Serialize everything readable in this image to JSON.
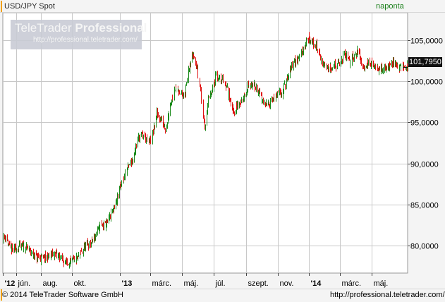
{
  "header": {
    "title": "USD/JPY Spot",
    "interval": "naponta"
  },
  "watermark": {
    "brand_plain": "TeleTrader",
    "brand_bold": "Professional",
    "url": "http://professional.teletrader.com/"
  },
  "footer": {
    "copyright": "© 2014 TeleTrader Software GmbH",
    "url": "http://professional.teletrader.com/"
  },
  "last_value_label": "101,7950",
  "colors": {
    "up": "#1a8a1a",
    "down": "#e01010",
    "grid": "#c8c8c8",
    "plot_background": "#ffffff",
    "frame": "#999999"
  },
  "chart_data": {
    "type": "candlestick",
    "instrument": "USD/JPY Spot",
    "frequency": "naponta",
    "grid": true,
    "y_axis_position": "right",
    "x_range": [
      "2012-05-20",
      "2014-07-10"
    ],
    "y_range": [
      76.6,
      108.4
    ],
    "y_ticks": [
      {
        "value": 80,
        "label": "80,0000"
      },
      {
        "value": 85,
        "label": "85,0000"
      },
      {
        "value": 90,
        "label": "90,0000"
      },
      {
        "value": 95,
        "label": "95,0000"
      },
      {
        "value": 100,
        "label": "100,0000"
      },
      {
        "value": 105,
        "label": "105,0000"
      }
    ],
    "x_ticks": [
      {
        "date": "2012-05-20",
        "label": "'12",
        "bold": true
      },
      {
        "date": "2012-06-15",
        "label": "jún.",
        "bold": false
      },
      {
        "date": "2012-08-01",
        "label": "aug.",
        "bold": false
      },
      {
        "date": "2012-10-01",
        "label": "okt.",
        "bold": false
      },
      {
        "date": "2013-01-01",
        "label": "'13",
        "bold": true
      },
      {
        "date": "2013-03-01",
        "label": "márc.",
        "bold": false
      },
      {
        "date": "2013-05-01",
        "label": "máj.",
        "bold": false
      },
      {
        "date": "2013-07-01",
        "label": "júl.",
        "bold": false
      },
      {
        "date": "2013-09-01",
        "label": "szept.",
        "bold": false
      },
      {
        "date": "2013-11-01",
        "label": "nov.",
        "bold": false
      },
      {
        "date": "2014-01-01",
        "label": "'14",
        "bold": true
      },
      {
        "date": "2014-03-01",
        "label": "márc.",
        "bold": false
      },
      {
        "date": "2014-05-01",
        "label": "máj.",
        "bold": false
      }
    ],
    "last_value": 101.795,
    "close_path": [
      [
        "2012-05-20",
        80.8
      ],
      [
        "2012-05-25",
        81.2
      ],
      [
        "2012-06-01",
        79.6
      ],
      [
        "2012-06-10",
        79.4
      ],
      [
        "2012-06-20",
        79.9
      ],
      [
        "2012-07-01",
        79.7
      ],
      [
        "2012-07-10",
        79.4
      ],
      [
        "2012-07-20",
        78.6
      ],
      [
        "2012-07-31",
        78.4
      ],
      [
        "2012-08-10",
        78.5
      ],
      [
        "2012-08-25",
        78.9
      ],
      [
        "2012-09-05",
        78.7
      ],
      [
        "2012-09-15",
        78.0
      ],
      [
        "2012-09-25",
        77.9
      ],
      [
        "2012-10-10",
        78.3
      ],
      [
        "2012-10-25",
        79.8
      ],
      [
        "2012-11-05",
        80.2
      ],
      [
        "2012-11-15",
        81.3
      ],
      [
        "2012-11-25",
        82.5
      ],
      [
        "2012-12-05",
        82.4
      ],
      [
        "2012-12-15",
        83.8
      ],
      [
        "2012-12-25",
        85.4
      ],
      [
        "2013-01-05",
        87.9
      ],
      [
        "2013-01-15",
        89.4
      ],
      [
        "2013-01-25",
        90.5
      ],
      [
        "2013-02-05",
        93.2
      ],
      [
        "2013-02-15",
        93.5
      ],
      [
        "2013-02-25",
        92.5
      ],
      [
        "2013-03-05",
        93.5
      ],
      [
        "2013-03-12",
        96.1
      ],
      [
        "2013-03-20",
        95.4
      ],
      [
        "2013-03-31",
        94.2
      ],
      [
        "2013-04-05",
        96.5
      ],
      [
        "2013-04-15",
        99.2
      ],
      [
        "2013-04-25",
        98.9
      ],
      [
        "2013-05-05",
        97.9
      ],
      [
        "2013-05-12",
        101.5
      ],
      [
        "2013-05-22",
        103.4
      ],
      [
        "2013-05-28",
        101.9
      ],
      [
        "2013-06-03",
        100.0
      ],
      [
        "2013-06-07",
        97.7
      ],
      [
        "2013-06-13",
        94.3
      ],
      [
        "2013-06-20",
        97.8
      ],
      [
        "2013-06-27",
        98.5
      ],
      [
        "2013-07-05",
        101.0
      ],
      [
        "2013-07-10",
        100.2
      ],
      [
        "2013-07-20",
        100.3
      ],
      [
        "2013-07-31",
        98.1
      ],
      [
        "2013-08-08",
        96.3
      ],
      [
        "2013-08-20",
        97.5
      ],
      [
        "2013-08-31",
        98.1
      ],
      [
        "2013-09-05",
        99.7
      ],
      [
        "2013-09-20",
        99.4
      ],
      [
        "2013-09-30",
        98.0
      ],
      [
        "2013-10-08",
        96.9
      ],
      [
        "2013-10-20",
        97.8
      ],
      [
        "2013-10-31",
        98.3
      ],
      [
        "2013-11-08",
        98.7
      ],
      [
        "2013-11-20",
        100.2
      ],
      [
        "2013-11-30",
        102.3
      ],
      [
        "2013-12-10",
        102.6
      ],
      [
        "2013-12-20",
        104.1
      ],
      [
        "2013-12-31",
        105.3
      ],
      [
        "2014-01-05",
        104.8
      ],
      [
        "2014-01-15",
        104.3
      ],
      [
        "2014-01-25",
        102.3
      ],
      [
        "2014-02-05",
        101.7
      ],
      [
        "2014-02-15",
        101.9
      ],
      [
        "2014-02-28",
        102.1
      ],
      [
        "2014-03-10",
        103.3
      ],
      [
        "2014-03-20",
        102.4
      ],
      [
        "2014-03-31",
        103.5
      ],
      [
        "2014-04-05",
        103.6
      ],
      [
        "2014-04-15",
        101.8
      ],
      [
        "2014-04-25",
        102.3
      ],
      [
        "2014-05-08",
        101.8
      ],
      [
        "2014-05-20",
        101.4
      ],
      [
        "2014-05-31",
        101.8
      ],
      [
        "2014-06-08",
        102.5
      ],
      [
        "2014-06-20",
        101.9
      ],
      [
        "2014-07-02",
        101.8
      ],
      [
        "2014-07-10",
        101.795
      ]
    ]
  }
}
